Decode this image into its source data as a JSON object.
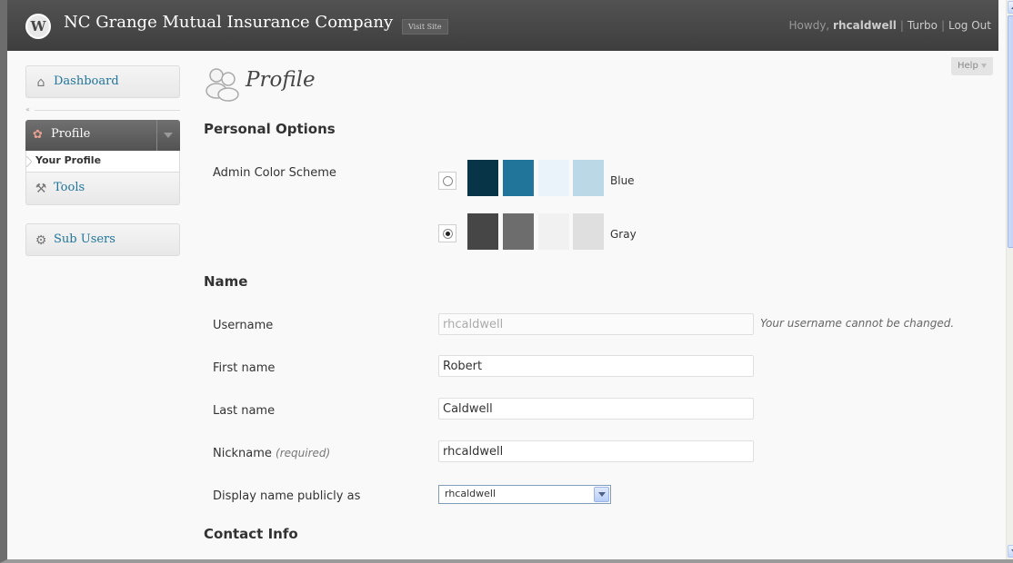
{
  "header": {
    "site_title": "NC Grange Mutual Insurance Company",
    "visit_site": "Visit Site",
    "howdy_prefix": "Howdy, ",
    "username": "rhcaldwell",
    "turbo": "Turbo",
    "logout": "Log Out",
    "separator": "|"
  },
  "help": {
    "label": "Help"
  },
  "sidebar": {
    "dashboard": "Dashboard",
    "collapse": "«",
    "profile": "Profile",
    "your_profile": "Your Profile",
    "tools": "Tools",
    "sub_users": "Sub Users"
  },
  "page": {
    "title": "Profile"
  },
  "personal_options": {
    "title": "Personal Options",
    "admin_color_scheme_label": "Admin Color Scheme",
    "schemes": [
      {
        "name": "Blue",
        "selected": false,
        "colors": [
          "#073447",
          "#21759b",
          "#eaf3fa",
          "#bbd8e7"
        ]
      },
      {
        "name": "Gray",
        "selected": true,
        "colors": [
          "#464646",
          "#6d6d6d",
          "#f1f1f1",
          "#dfdfdf"
        ]
      }
    ]
  },
  "name": {
    "title": "Name",
    "username_label": "Username",
    "username_value": "rhcaldwell",
    "username_note": "Your username cannot be changed.",
    "first_name_label": "First name",
    "first_name_value": "Robert",
    "last_name_label": "Last name",
    "last_name_value": "Caldwell",
    "nickname_label": "Nickname",
    "nickname_required": "(required)",
    "nickname_value": "rhcaldwell",
    "display_name_label": "Display name publicly as",
    "display_name_value": "rhcaldwell"
  },
  "contact_info": {
    "title": "Contact Info"
  }
}
